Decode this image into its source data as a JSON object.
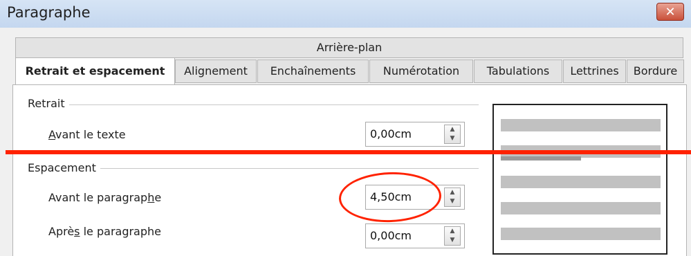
{
  "window": {
    "title": "Paragraphe",
    "close_glyph": "✕"
  },
  "tabs": {
    "row1": "Arrière-plan",
    "row2": [
      "Retrait et espacement",
      "Alignement",
      "Enchaînements",
      "Numérotation",
      "Tabulations",
      "Lettrines",
      "Bordure"
    ],
    "active": "Retrait et espacement"
  },
  "indent": {
    "section_label": "Retrait",
    "before_text": {
      "label_mnemonic": "A",
      "label_rest": "vant le texte",
      "value": "0,00cm"
    }
  },
  "spacing": {
    "section_label": "Espacement",
    "above_paragraph": {
      "label_pre": "Avant le paragrap",
      "label_mnemonic": "h",
      "label_post": "e",
      "value": "4,50cm"
    },
    "below_paragraph": {
      "label_pre": "Aprè",
      "label_mnemonic": "s",
      "label_post": " le paragraphe",
      "value": "0,00cm"
    }
  },
  "icons": {
    "spin_up": "▲",
    "spin_down": "▼"
  },
  "annotation_color": "#ff2200"
}
